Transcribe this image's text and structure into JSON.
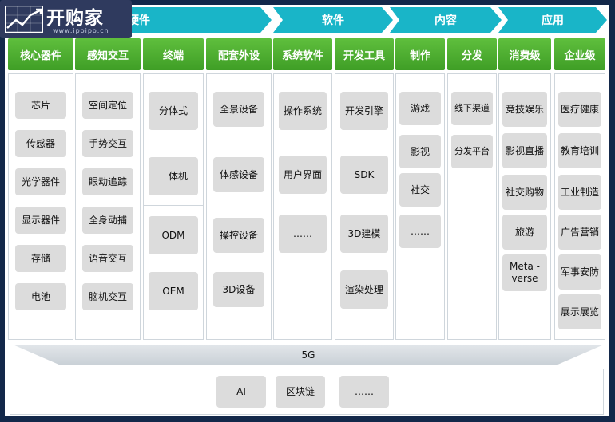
{
  "categories": {
    "hardware": "硬件",
    "software": "软件",
    "content": "内容",
    "application": "应用"
  },
  "columns": [
    {
      "header": "核心器件",
      "items": [
        "芯片",
        "传感器",
        "光学器件",
        "显示器件",
        "存储",
        "电池"
      ]
    },
    {
      "header": "感知交互",
      "items": [
        "空间定位",
        "手势交互",
        "眼动追踪",
        "全身动捕",
        "语音交互",
        "脑机交互"
      ]
    },
    {
      "header": "终端",
      "items_top": [
        "分体式",
        "一体机"
      ],
      "items_bottom": [
        "ODM",
        "OEM"
      ]
    },
    {
      "header": "配套外设",
      "items": [
        "全景设备",
        "体感设备",
        "操控设备",
        "3D设备"
      ]
    },
    {
      "header": "系统软件",
      "items": [
        "操作系统",
        "用户界面",
        "……"
      ]
    },
    {
      "header": "开发工具",
      "items": [
        "开发引擎",
        "SDK",
        "3D建模",
        "渲染处理"
      ]
    },
    {
      "header": "制作",
      "items": [
        "游戏",
        "影视",
        "社交",
        "……"
      ]
    },
    {
      "header": "分发",
      "items": [
        "线下渠道",
        "分发平台"
      ]
    },
    {
      "header": "消费级",
      "items": [
        "竞技娱乐",
        "影视直播",
        "社交购物",
        "旅游",
        "Meta -\nverse"
      ]
    },
    {
      "header": "企业级",
      "items": [
        "医疗健康",
        "教育培训",
        "工业制造",
        "广告营销",
        "军事安防",
        "展示展览"
      ]
    }
  ],
  "network": "5G",
  "base": [
    "AI",
    "区块链",
    "……"
  ],
  "logo": {
    "title": "开购家",
    "subtitle": "www.ipoipo.cn"
  },
  "colors": {
    "arrow": "#19b5c8",
    "header": "#4aab2d",
    "tile": "#dcdcdc",
    "frame": "#13284a"
  }
}
